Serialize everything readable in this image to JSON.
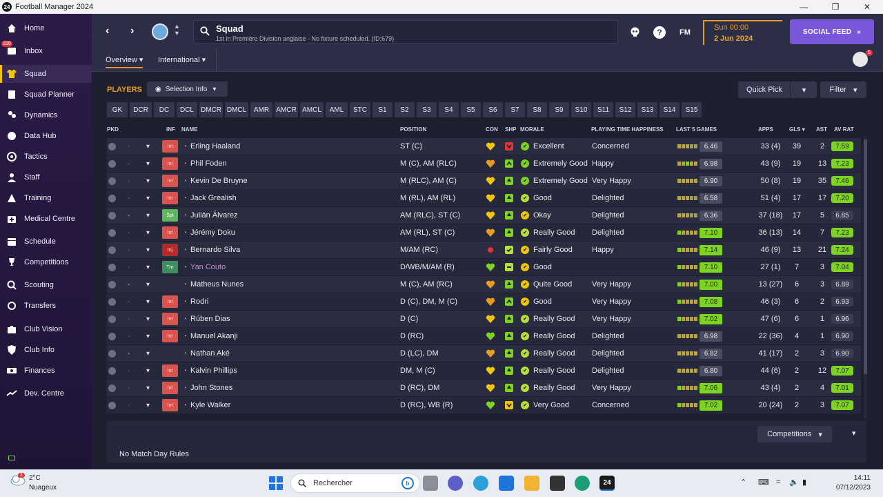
{
  "window": {
    "title": "Football Manager 2024",
    "app_icon": "24"
  },
  "sidebar": {
    "inbox_badge": "150",
    "items": [
      {
        "label": "Home",
        "icon": "home-icon"
      },
      {
        "label": "Inbox",
        "icon": "inbox-icon"
      },
      {
        "label": "Squad",
        "icon": "shirt-icon",
        "active": true
      },
      {
        "label": "Squad Planner",
        "icon": "clipboard-icon"
      },
      {
        "label": "Dynamics",
        "icon": "people-icon"
      },
      {
        "label": "Data Hub",
        "icon": "data-hub-icon"
      },
      {
        "label": "Tactics",
        "icon": "tactics-icon"
      },
      {
        "label": "Staff",
        "icon": "staff-icon"
      },
      {
        "label": "Training",
        "icon": "training-icon"
      },
      {
        "label": "Medical Centre",
        "icon": "medical-icon"
      },
      {
        "label": "Schedule",
        "icon": "calendar-icon"
      },
      {
        "label": "Competitions",
        "icon": "trophy-icon"
      },
      {
        "label": "Scouting",
        "icon": "scouting-icon"
      },
      {
        "label": "Transfers",
        "icon": "transfers-icon"
      },
      {
        "label": "Club Vision",
        "icon": "briefcase-icon"
      },
      {
        "label": "Club Info",
        "icon": "shield-icon"
      },
      {
        "label": "Finances",
        "icon": "money-icon"
      },
      {
        "label": "Dev. Centre",
        "icon": "dev-centre-icon"
      }
    ]
  },
  "header": {
    "page_title": "Squad",
    "subtitle": "1st in Première Division anglaise - No fixture scheduled. (ID:679)",
    "fm_label": "FM",
    "help_label": "?",
    "time": "Sun 00:00",
    "date": "2 Jun 2024",
    "social_feed": "SOCIAL FEED",
    "social_arrow": "»"
  },
  "subtabs": {
    "overview": "Overview",
    "international": "International",
    "avatar_badge": "5"
  },
  "toolbar": {
    "players_label": "PLAYERS",
    "selection_info": "Selection Info",
    "quick_pick": "Quick Pick",
    "filter": "Filter"
  },
  "positions": [
    "GK",
    "DCR",
    "DC",
    "DCL",
    "DMCR",
    "DMCL",
    "AMR",
    "AMCR",
    "AMCL",
    "AML",
    "STC",
    "S1",
    "S2",
    "S3",
    "S4",
    "S5",
    "S6",
    "S7",
    "S8",
    "S9",
    "S10",
    "S11",
    "S12",
    "S13",
    "S14",
    "S15"
  ],
  "columns": {
    "pkd": "PKD",
    "inf": "INF",
    "name": "NAME",
    "position": "POSITION",
    "con": "CON",
    "shp": "SHP",
    "morale": "MORALE",
    "happiness": "PLAYING TIME HAPPINESS",
    "last5": "LAST 5 GAMES",
    "apps": "APPS",
    "gls": "GLS",
    "ast": "AST",
    "avrat": "AV RAT"
  },
  "colors": {
    "accent": "#e89b22",
    "social": "#7a56d8",
    "good": "#7ed321",
    "warn": "#f1c40f",
    "int_tag": "#d9534f",
    "inj_tag": "#b52a2a",
    "spt_tag": "#5cb85c",
    "trn_tag": "#3e8e5f"
  },
  "players": [
    {
      "pkd_sel": "-",
      "inf": "Int",
      "name": "Erling Haaland",
      "position": "ST (C)",
      "con": "yellow",
      "shp": "red",
      "morale": "Excellent",
      "morale_color": "#7ed321",
      "happiness": "Concerned",
      "last5": "6.46",
      "last5_hi": false,
      "apps": "33 (4)",
      "gls": "39",
      "ast": "2",
      "avrat": "7.59",
      "avrat_hi": true
    },
    {
      "pkd_sel": "-",
      "inf": "Int",
      "name": "Phil Foden",
      "position": "M (C), AM (RLC)",
      "con": "orange",
      "shp": "up",
      "morale": "Extremely Good",
      "morale_color": "#7ed321",
      "happiness": "Happy",
      "last5": "6.98",
      "last5_hi": false,
      "apps": "43 (9)",
      "gls": "19",
      "ast": "13",
      "avrat": "7.23",
      "avrat_hi": true
    },
    {
      "pkd_sel": "-",
      "inf": "Int",
      "name": "Kevin De Bruyne",
      "position": "M (RLC), AM (C)",
      "con": "yellow",
      "shp": "green",
      "morale": "Extremely Good",
      "morale_color": "#7ed321",
      "happiness": "Very Happy",
      "last5": "6.90",
      "last5_hi": false,
      "apps": "50 (8)",
      "gls": "19",
      "ast": "35",
      "avrat": "7.46",
      "avrat_hi": true
    },
    {
      "pkd_sel": "-",
      "inf": "Int",
      "name": "Jack Grealish",
      "position": "M (RL), AM (RL)",
      "con": "yellow",
      "shp": "green",
      "morale": "Good",
      "morale_color": "#b8e03a",
      "happiness": "Delighted",
      "last5": "6.58",
      "last5_hi": false,
      "apps": "51 (4)",
      "gls": "17",
      "ast": "17",
      "avrat": "7.20",
      "avrat_hi": true
    },
    {
      "pkd_sel": "-",
      "inf": "Spt",
      "name": "Julián Álvarez",
      "position": "AM (RLC), ST (C)",
      "con": "yellow",
      "shp": "green",
      "morale": "Okay",
      "morale_color": "#f1c40f",
      "happiness": "Delighted",
      "last5": "6.36",
      "last5_hi": false,
      "apps": "37 (18)",
      "gls": "17",
      "ast": "5",
      "avrat": "6.85",
      "avrat_hi": false
    },
    {
      "pkd_sel": "-",
      "inf": "Int",
      "name": "Jérémy Doku",
      "position": "AM (RL), ST (C)",
      "con": "orange",
      "shp": "green",
      "morale": "Really Good",
      "morale_color": "#b8e03a",
      "happiness": "Delighted",
      "last5": "7.10",
      "last5_hi": true,
      "apps": "36 (13)",
      "gls": "14",
      "ast": "7",
      "avrat": "7.23",
      "avrat_hi": true
    },
    {
      "pkd_sel": "-",
      "inf": "Inj",
      "name": "Bernardo Silva",
      "position": "M/AM (RC)",
      "con": "red",
      "shp": "check",
      "morale": "Fairly Good",
      "morale_color": "#f1c40f",
      "happiness": "Happy",
      "last5": "7.14",
      "last5_hi": true,
      "apps": "46 (9)",
      "gls": "13",
      "ast": "21",
      "avrat": "7.24",
      "avrat_hi": true
    },
    {
      "pkd_sel": "-",
      "inf": "Trn",
      "name": "Yan Couto",
      "position": "D/WB/M/AM (R)",
      "con": "green",
      "shp": "neutral",
      "morale": "Good",
      "morale_color": "#f1c40f",
      "happiness": "",
      "last5": "7.10",
      "last5_hi": true,
      "apps": "27 (1)",
      "gls": "7",
      "ast": "3",
      "avrat": "7.04",
      "avrat_hi": true
    },
    {
      "pkd_sel": "-",
      "inf": "",
      "name": "Matheus Nunes",
      "position": "M (C), AM (RC)",
      "con": "orange",
      "shp": "green",
      "morale": "Quite Good",
      "morale_color": "#f1c40f",
      "happiness": "Very Happy",
      "last5": "7.00",
      "last5_hi": true,
      "apps": "13 (27)",
      "gls": "6",
      "ast": "3",
      "avrat": "6.89",
      "avrat_hi": false
    },
    {
      "pkd_sel": "-",
      "inf": "Int",
      "name": "Rodri",
      "position": "D (C), DM, M (C)",
      "con": "orange",
      "shp": "up",
      "morale": "Good",
      "morale_color": "#f1c40f",
      "happiness": "Very Happy",
      "last5": "7.08",
      "last5_hi": true,
      "apps": "46 (3)",
      "gls": "6",
      "ast": "2",
      "avrat": "6.93",
      "avrat_hi": false
    },
    {
      "pkd_sel": "-",
      "inf": "Int",
      "name": "Rúben Dias",
      "position": "D (C)",
      "con": "yellow",
      "shp": "green",
      "morale": "Really Good",
      "morale_color": "#b8e03a",
      "happiness": "Very Happy",
      "last5": "7.02",
      "last5_hi": true,
      "apps": "47 (6)",
      "gls": "6",
      "ast": "1",
      "avrat": "6.96",
      "avrat_hi": false
    },
    {
      "pkd_sel": "-",
      "inf": "Int",
      "name": "Manuel Akanji",
      "position": "D (RC)",
      "con": "green",
      "shp": "green",
      "morale": "Really Good",
      "morale_color": "#b8e03a",
      "happiness": "Delighted",
      "last5": "6.98",
      "last5_hi": false,
      "apps": "22 (36)",
      "gls": "4",
      "ast": "1",
      "avrat": "6.90",
      "avrat_hi": false
    },
    {
      "pkd_sel": "-",
      "inf": "",
      "name": "Nathan Aké",
      "position": "D (LC), DM",
      "con": "orange",
      "shp": "green",
      "morale": "Really Good",
      "morale_color": "#b8e03a",
      "happiness": "Delighted",
      "last5": "6.82",
      "last5_hi": false,
      "apps": "41 (17)",
      "gls": "2",
      "ast": "3",
      "avrat": "6.90",
      "avrat_hi": false
    },
    {
      "pkd_sel": "-",
      "inf": "Int",
      "name": "Kalvin Phillips",
      "position": "DM, M (C)",
      "con": "yellow",
      "shp": "green",
      "morale": "Really Good",
      "morale_color": "#b8e03a",
      "happiness": "Delighted",
      "last5": "6.80",
      "last5_hi": false,
      "apps": "44 (6)",
      "gls": "2",
      "ast": "12",
      "avrat": "7.07",
      "avrat_hi": true
    },
    {
      "pkd_sel": "-",
      "inf": "Int",
      "name": "John Stones",
      "position": "D (RC), DM",
      "con": "yellow",
      "shp": "green",
      "morale": "Really Good",
      "morale_color": "#b8e03a",
      "happiness": "Very Happy",
      "last5": "7.06",
      "last5_hi": true,
      "apps": "43 (4)",
      "gls": "2",
      "ast": "4",
      "avrat": "7.01",
      "avrat_hi": true
    },
    {
      "pkd_sel": "-",
      "inf": "Int",
      "name": "Kyle Walker",
      "position": "D (RC), WB (R)",
      "con": "green",
      "shp": "down",
      "morale": "Very Good",
      "morale_color": "#b8e03a",
      "happiness": "Concerned",
      "last5": "7.02",
      "last5_hi": true,
      "apps": "20 (24)",
      "gls": "2",
      "ast": "3",
      "avrat": "7.07",
      "avrat_hi": true
    }
  ],
  "bottom": {
    "no_rules": "No Match Day Rules",
    "competitions": "Competitions"
  },
  "taskbar": {
    "weather_temp": "2°C",
    "weather_desc": "Nuageux",
    "weather_badge": "1",
    "search_placeholder": "Rechercher",
    "bing": "b",
    "fm_app": "24",
    "time": "14:11",
    "date": "07/12/2023"
  }
}
